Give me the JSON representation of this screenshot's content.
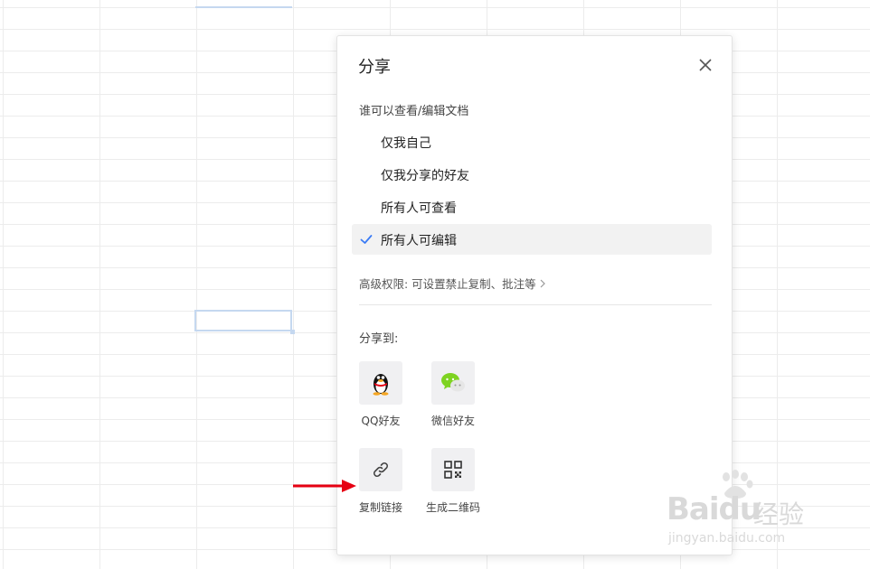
{
  "dialog": {
    "title": "分享",
    "close_icon": "close-icon",
    "permission_label": "谁可以查看/编辑文档",
    "options": [
      {
        "label": "仅我自己",
        "selected": false
      },
      {
        "label": "仅我分享的好友",
        "selected": false
      },
      {
        "label": "所有人可查看",
        "selected": false
      },
      {
        "label": "所有人可编辑",
        "selected": true
      }
    ],
    "advanced_link": "高级权限: 可设置禁止复制、批注等",
    "share_to_label": "分享到:",
    "share_targets": [
      {
        "label": "QQ好友",
        "icon": "qq-penguin-icon"
      },
      {
        "label": "微信好友",
        "icon": "wechat-icon"
      },
      {
        "label": "复制链接",
        "icon": "link-icon"
      },
      {
        "label": "生成二维码",
        "icon": "qr-code-icon"
      }
    ]
  },
  "watermark": {
    "brand": "Baidu",
    "tag": "经验",
    "url": "jingyan.baidu.com"
  },
  "colors": {
    "check": "#3a7bf5",
    "arrow": "#e60012",
    "selected_bg": "#f2f2f2",
    "cell_selection": "#c5d8f0"
  }
}
